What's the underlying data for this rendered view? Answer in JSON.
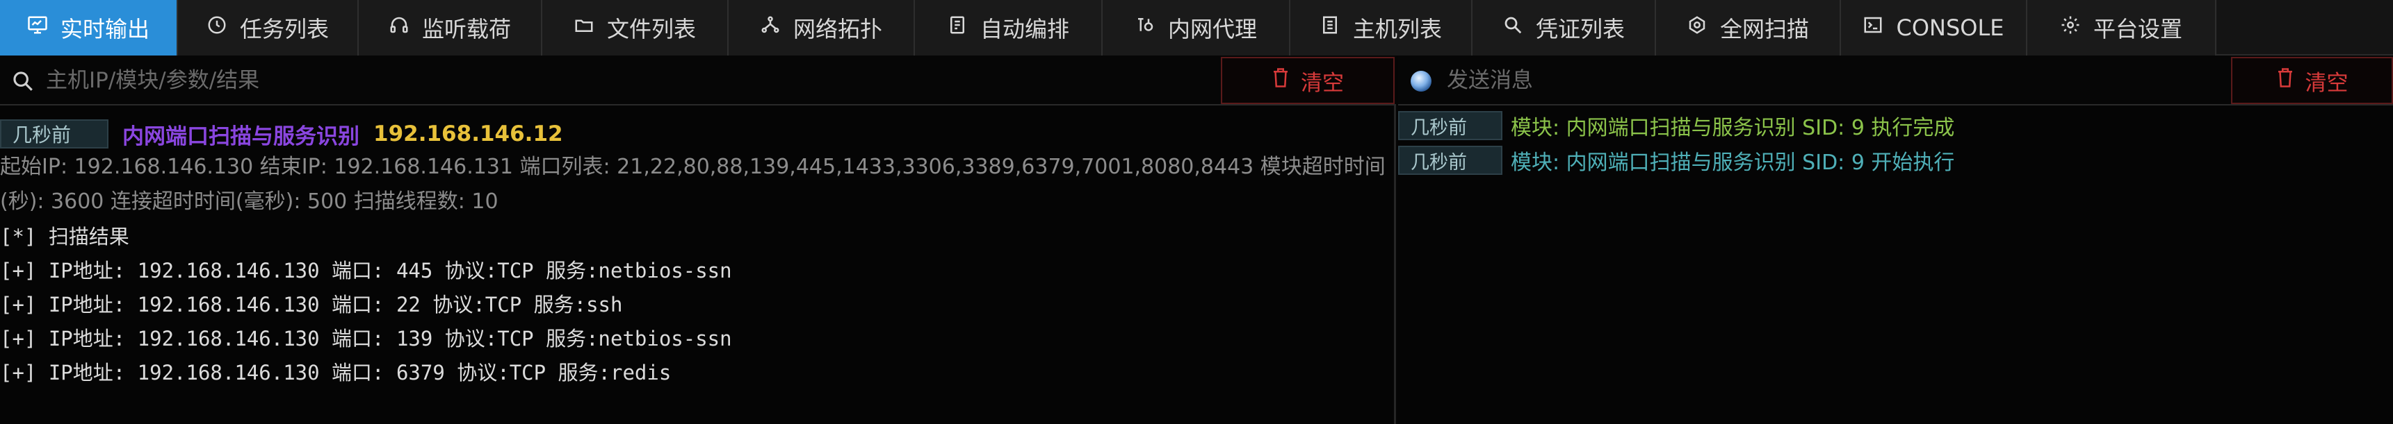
{
  "tabs": [
    {
      "label": "实时输出",
      "icon": "monitor-icon",
      "active": true
    },
    {
      "label": "任务列表",
      "icon": "clock-icon",
      "active": false
    },
    {
      "label": "监听载荷",
      "icon": "headphones-icon",
      "active": false
    },
    {
      "label": "文件列表",
      "icon": "folder-icon",
      "active": false
    },
    {
      "label": "网络拓扑",
      "icon": "topology-icon",
      "active": false
    },
    {
      "label": "自动编排",
      "icon": "workflow-icon",
      "active": false
    },
    {
      "label": "内网代理",
      "icon": "proxy-icon",
      "active": false
    },
    {
      "label": "主机列表",
      "icon": "host-list-icon",
      "active": false
    },
    {
      "label": "凭证列表",
      "icon": "key-search-icon",
      "active": false
    },
    {
      "label": "全网扫描",
      "icon": "radar-icon",
      "active": false
    },
    {
      "label": "CONSOLE",
      "icon": "console-icon",
      "active": false
    },
    {
      "label": "平台设置",
      "icon": "gear-icon",
      "active": false
    }
  ],
  "left": {
    "search": {
      "placeholder": "主机IP/模块/参数/结果",
      "value": ""
    },
    "clear_label": "清空",
    "log": {
      "time": "几秒前",
      "module": "内网端口扫描与服务识别",
      "ip": "192.168.146.12",
      "params": "起始IP: 192.168.146.130 结束IP: 192.168.146.131 端口列表: 21,22,80,88,139,445,1433,3306,3389,6379,7001,8080,8443 模块超时时间(秒): 3600 连接超时时间(毫秒): 500 扫描线程数: 10",
      "lines": [
        "[*] 扫描结果",
        "[+] IP地址: 192.168.146.130 端口: 445 协议:TCP 服务:netbios-ssn",
        "[+] IP地址: 192.168.146.130 端口: 22 协议:TCP 服务:ssh",
        "[+] IP地址: 192.168.146.130 端口: 139 协议:TCP 服务:netbios-ssn",
        "[+] IP地址: 192.168.146.130 端口: 6379 协议:TCP 服务:redis"
      ]
    }
  },
  "right": {
    "message": {
      "placeholder": "发送消息",
      "value": ""
    },
    "clear_label": "清空",
    "events": [
      {
        "time": "几秒前",
        "text": "模块: 内网端口扫描与服务识别 SID: 9 执行完成",
        "color": "#8bc34a"
      },
      {
        "time": "几秒前",
        "text": "模块: 内网端口扫描与服务识别 SID: 9 开始执行",
        "color": "#4fb0b8"
      }
    ]
  },
  "colors": {
    "accent": "#2a8ed8",
    "danger": "#d83a3a",
    "module": "#8a46e0",
    "ip": "#e8c13a"
  }
}
